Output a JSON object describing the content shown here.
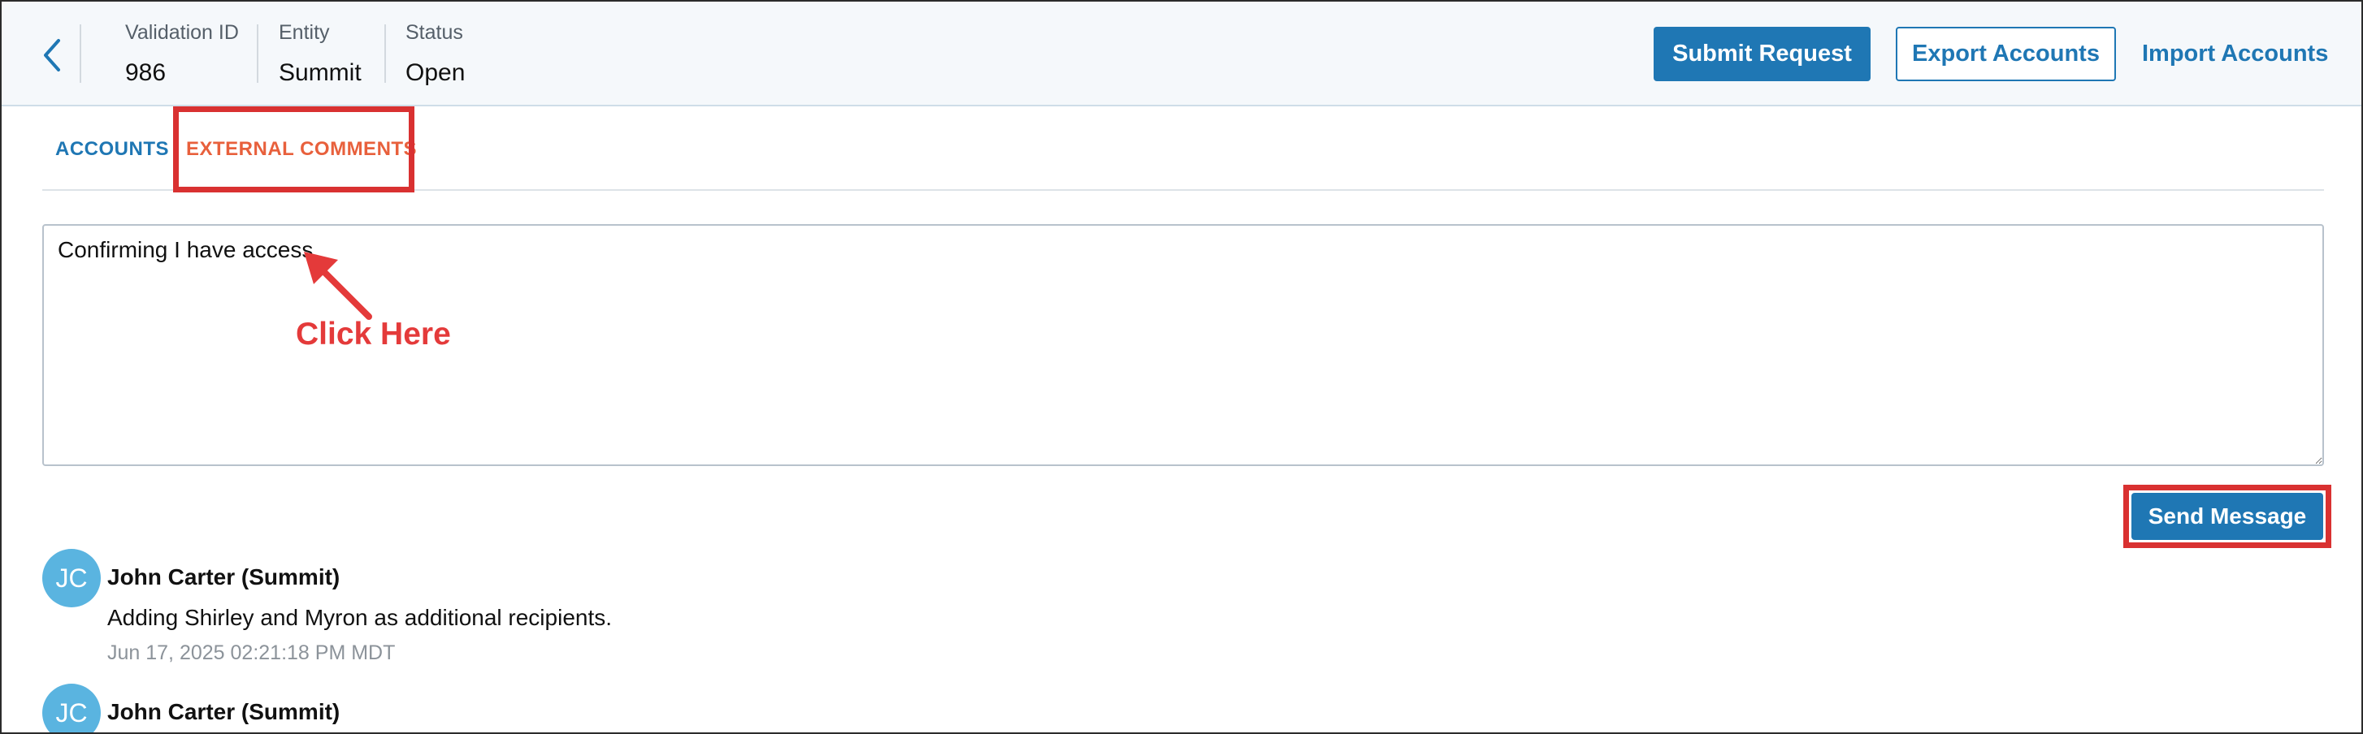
{
  "header": {
    "meta": [
      {
        "label": "Validation ID",
        "value": "986"
      },
      {
        "label": "Entity",
        "value": "Summit"
      },
      {
        "label": "Status",
        "value": "Open"
      }
    ],
    "buttons": {
      "submit": "Submit Request",
      "export": "Export Accounts",
      "import": "Import Accounts"
    },
    "back_icon": "chevron-left-icon"
  },
  "tabs": [
    {
      "label": "ACCOUNTS",
      "active": false
    },
    {
      "label": "EXTERNAL COMMENTS",
      "active": true
    }
  ],
  "comment": {
    "value": "Confirming I have access."
  },
  "annotation": {
    "text": "Click Here",
    "color": "#e43a3a"
  },
  "send_button": "Send Message",
  "messages": [
    {
      "initials": "JC",
      "author": "John Carter (Summit)",
      "body": "Adding Shirley and Myron as additional recipients.",
      "time": "Jun 17, 2025 02:21:18 PM MDT"
    },
    {
      "initials": "JC",
      "author": "John Carter (Summit)"
    }
  ],
  "colors": {
    "primary": "#1f77b4",
    "active_tab": "#e8603c",
    "highlight": "#d93131",
    "avatar": "#5ab4e0"
  }
}
